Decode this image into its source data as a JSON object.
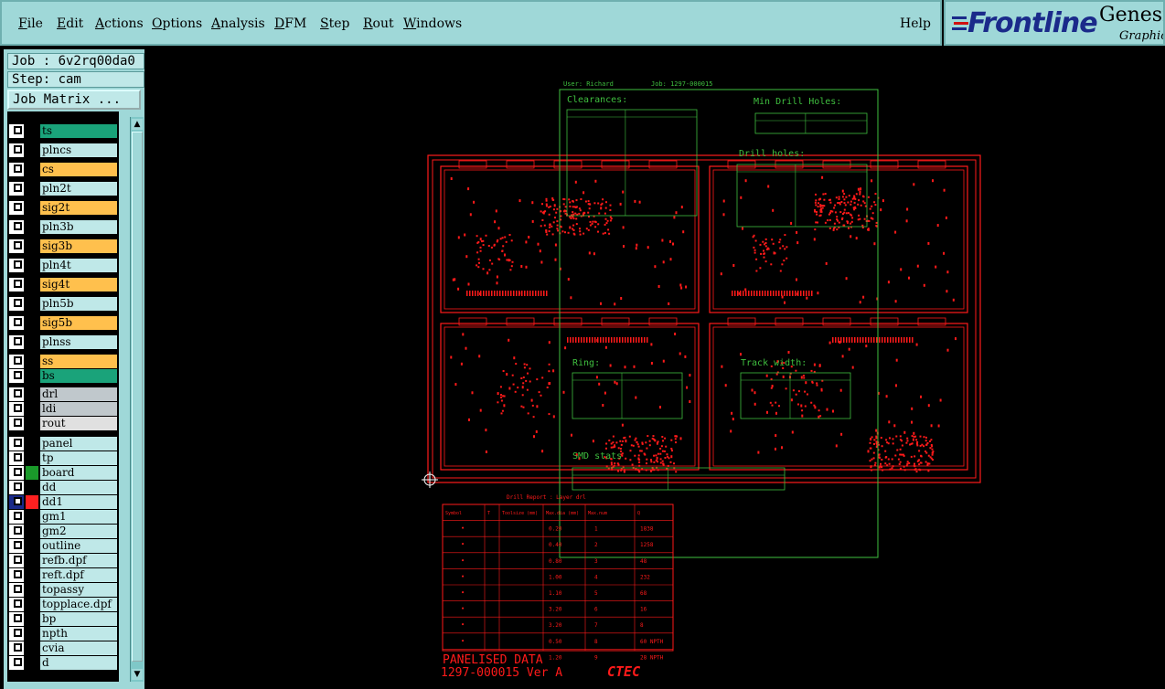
{
  "menu": {
    "items": [
      "File",
      "Edit",
      "Actions",
      "Options",
      "Analysis",
      "DFM",
      "Step",
      "Rout",
      "Windows"
    ],
    "help": "Help"
  },
  "brand": {
    "logo": "Frontline",
    "product": "Genesis",
    "sub": "Graphic"
  },
  "side": {
    "job": "Job : 6v2rq00da0",
    "step": "Step: cam",
    "job_matrix": "Job Matrix ..."
  },
  "layers": [
    {
      "name": "ts",
      "color": "#1aa37a"
    },
    {
      "name": "plncs",
      "color": "#bfe8e8"
    },
    {
      "name": "cs",
      "color": "#ffc04d"
    },
    {
      "name": "pln2t",
      "color": "#bfe8e8"
    },
    {
      "name": "sig2t",
      "color": "#ffc04d"
    },
    {
      "name": "pln3b",
      "color": "#bfe8e8"
    },
    {
      "name": "sig3b",
      "color": "#ffc04d"
    },
    {
      "name": "pln4t",
      "color": "#bfe8e8"
    },
    {
      "name": "sig4t",
      "color": "#ffc04d"
    },
    {
      "name": "pln5b",
      "color": "#bfe8e8"
    },
    {
      "name": "sig5b",
      "color": "#ffc04d"
    },
    {
      "name": "plnss",
      "color": "#bfe8e8"
    },
    {
      "name": "ss",
      "color": "#ffc04d"
    },
    {
      "name": "bs",
      "color": "#1aa37a"
    },
    {
      "name": "drl",
      "color": "#c0c8cc"
    },
    {
      "name": "ldi",
      "color": "#c0c8cc"
    },
    {
      "name": "rout",
      "color": "#e0e0e0"
    },
    {
      "name": "panel",
      "color": "#bfe8e8"
    },
    {
      "name": "tp",
      "color": "#bfe8e8"
    },
    {
      "name": "board",
      "color": "#bfe8e8"
    },
    {
      "name": "dd",
      "color": "#bfe8e8"
    },
    {
      "name": "dd1",
      "color": "#bfe8e8"
    },
    {
      "name": "gm1",
      "color": "#bfe8e8"
    },
    {
      "name": "gm2",
      "color": "#bfe8e8"
    },
    {
      "name": "outline",
      "color": "#bfe8e8"
    },
    {
      "name": "refb.dpf",
      "color": "#bfe8e8"
    },
    {
      "name": "reft.dpf",
      "color": "#bfe8e8"
    },
    {
      "name": "topassy",
      "color": "#bfe8e8"
    },
    {
      "name": "topplace.dpf",
      "color": "#bfe8e8"
    },
    {
      "name": "bp",
      "color": "#bfe8e8"
    },
    {
      "name": "npth",
      "color": "#bfe8e8"
    },
    {
      "name": "cvia",
      "color": "#bfe8e8"
    },
    {
      "name": "d",
      "color": "#bfe8e8"
    }
  ],
  "canvas": {
    "user": "User: Richard",
    "job_no": "Job: 1297-000015",
    "clearances": "Clearances:",
    "min_drill": "Min Drill Holes:",
    "drill_holes": "Drill holes:",
    "ring": "Ring:",
    "track_width": "Track width:",
    "smd": "SMD stats",
    "drill_report": "Drill Report : Layer drl",
    "drill_headers": [
      "Symbol",
      "T",
      "Toolsize (mm)",
      "Max.dia (mm)",
      "Max.num",
      "Q"
    ],
    "drill_sizes": [
      "0.20",
      "0.40",
      "0.80",
      "1.00",
      "1.10",
      "3.20",
      "3.20",
      "0.50",
      "1.20"
    ],
    "drill_nums": [
      "1",
      "2",
      "3",
      "4",
      "5",
      "6",
      "7",
      "8",
      "9"
    ],
    "drill_qty": [
      "1838",
      "1258",
      "48",
      "232",
      "68",
      "16",
      "8",
      "60 NPTH",
      "28 NPTH"
    ],
    "panelised": "PANELISED DATA",
    "part": "1297-000015 Ver A",
    "logo": "CTEC"
  }
}
